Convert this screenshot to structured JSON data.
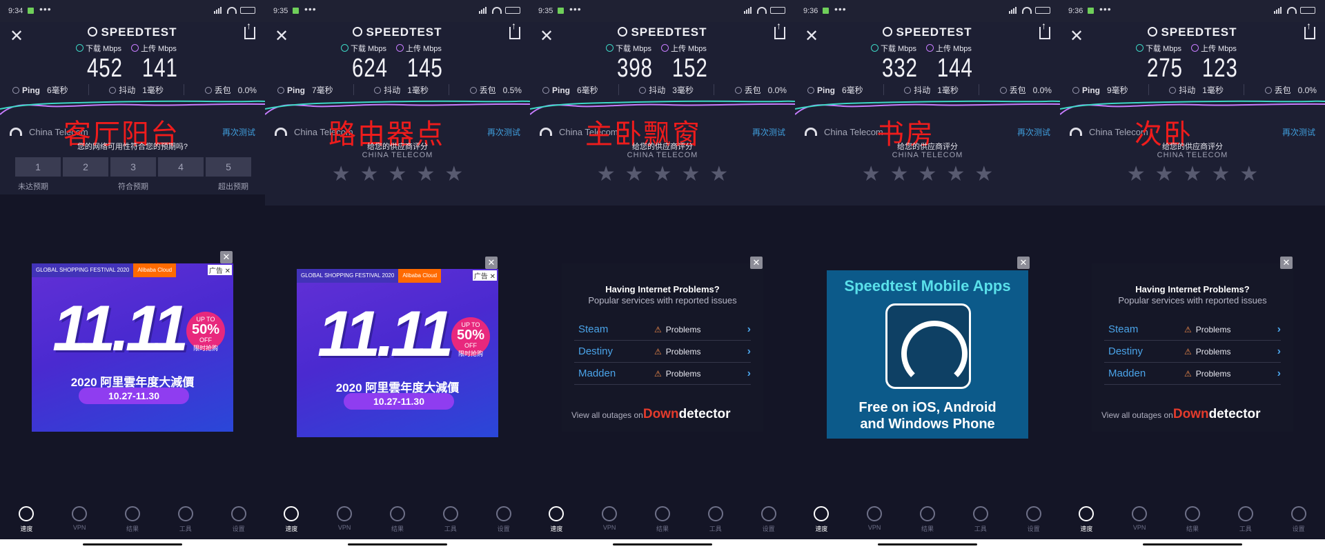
{
  "labels": {
    "brand": "SPEEDTEST",
    "download": "下载 Mbps",
    "upload": "上传 Mbps",
    "ping": "Ping",
    "jitter": "抖动",
    "loss": "丢包",
    "provider": "China Telecom",
    "retest": "再次测试",
    "rate_provider": "给您的供应商评分",
    "provider_caps": "CHINA TELECOM",
    "nav": [
      "速度",
      "VPN",
      "结果",
      "工具",
      "设置"
    ]
  },
  "panels": [
    {
      "time": "9:34",
      "room": "客厅阳台",
      "download": "452",
      "upload": "141",
      "ping": "6毫秒",
      "jitter": "1毫秒",
      "loss": "0.0%",
      "question": "您的网络可用性符合您的预期吗?",
      "ratings": [
        "1",
        "2",
        "3",
        "4",
        "5"
      ],
      "rating_labels": [
        "未达预期",
        "符合预期",
        "超出预期"
      ],
      "ad": "aliyun"
    },
    {
      "time": "9:35",
      "room": "路由器点",
      "download": "624",
      "upload": "145",
      "ping": "7毫秒",
      "jitter": "1毫秒",
      "loss": "0.5%",
      "ad": "aliyun"
    },
    {
      "time": "9:35",
      "room": "主卧飘窗",
      "download": "398",
      "upload": "152",
      "ping": "6毫秒",
      "jitter": "3毫秒",
      "loss": "0.0%",
      "ad": "downdetector"
    },
    {
      "time": "9:36",
      "room": "书房",
      "download": "332",
      "upload": "144",
      "ping": "6毫秒",
      "jitter": "1毫秒",
      "loss": "0.0%",
      "ad": "speedtest"
    },
    {
      "time": "9:36",
      "room": "次卧",
      "download": "275",
      "upload": "123",
      "ping": "9毫秒",
      "jitter": "1毫秒",
      "loss": "0.0%",
      "ad": "downdetector"
    }
  ],
  "ads": {
    "aliyun": {
      "logo1": "GLOBAL SHOPPING FESTIVAL 2020",
      "logo2": "Alibaba Cloud",
      "tag": "广告",
      "big": "11.11",
      "badge_top": "UP TO",
      "badge_pct": "50%",
      "badge_off": "OFF",
      "badge_cn": "限时抢购",
      "subtitle": "2020 阿里雲年度大減價",
      "dates": "10.27-11.30"
    },
    "downdetector": {
      "title": "Having Internet Problems?",
      "subtitle": "Popular services with reported issues",
      "services": [
        "Steam",
        "Destiny",
        "Madden"
      ],
      "status": "Problems",
      "footer": "View all outages on",
      "brand_a": "Down",
      "brand_b": "detector"
    },
    "speedtest": {
      "title": "Speedtest Mobile Apps",
      "line1": "Free on iOS, Android",
      "line2": "and Windows Phone"
    }
  }
}
